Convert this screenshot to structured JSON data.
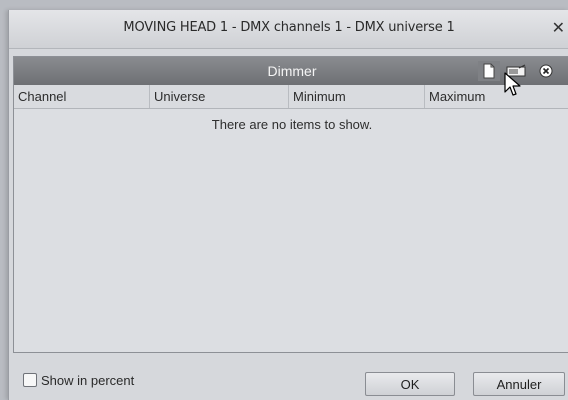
{
  "window": {
    "title": "MOVING HEAD  1 - DMX channels 1 - DMX universe 1",
    "close_glyph": "✕"
  },
  "panel": {
    "title": "Dimmer",
    "toolbar_icons": [
      "new-document-icon",
      "edit-icon",
      "delete-icon"
    ],
    "columns": [
      "Channel",
      "Universe",
      "Minimum",
      "Maximum"
    ],
    "rows": [],
    "empty_message": "There are no items to show."
  },
  "footer": {
    "show_in_percent_label": "Show in percent",
    "show_in_percent_checked": false,
    "ok_label": "OK",
    "cancel_label": "Annuler"
  },
  "colors": {
    "panel_header": "#7c7e82",
    "window_bg": "#d6d8dc"
  }
}
